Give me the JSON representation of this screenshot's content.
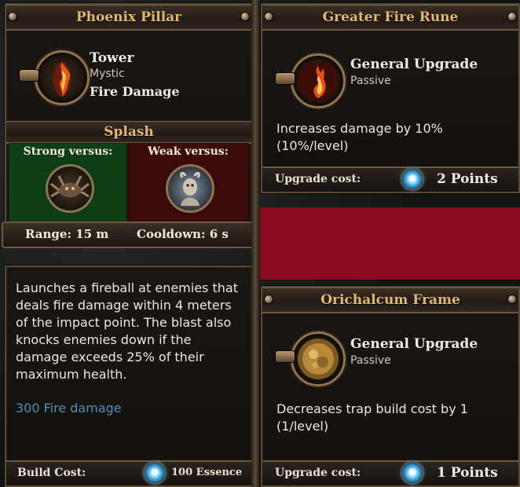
{
  "tower_card": {
    "title": "Phoenix Pillar",
    "type": "Tower",
    "school": "Mystic",
    "damage_type": "Fire Damage",
    "splash_label": "Splash",
    "strong_label": "Strong versus:",
    "weak_label": "Weak versus:",
    "range": "Range: 15 m",
    "cooldown": "Cooldown: 6 s",
    "description": "Launches a fireball at enemies that deals fire damage within 4 meters of the impact point. The blast also knocks enemies down if the damage exceeds 25% of their maximum health.",
    "stat": "300 Fire damage",
    "build_cost_label": "Build Cost:",
    "build_cost_value": "100 Essence"
  },
  "upgrade_1": {
    "title": "Greater Fire Rune",
    "category": "General Upgrade",
    "kind": "Passive",
    "description": "Increases damage by 10% (10%/level)",
    "cost_label": "Upgrade cost:",
    "cost_value": "2 Points"
  },
  "upgrade_2": {
    "title": "Orichalcum Frame",
    "category": "General Upgrade",
    "kind": "Passive",
    "description": "Decreases trap build cost by 1 (1/level)",
    "cost_label": "Upgrade cost:",
    "cost_value": "1 Points"
  },
  "colors": {
    "title_gold": "#e2b86e",
    "strong_bg": "#0f3d14",
    "weak_bg": "#3b0a0a",
    "stat_blue": "#4f8fb8",
    "redaction": "#8c0a1e"
  },
  "icons": {
    "tower": "phoenix-pillar-icon",
    "upgrade_1": "fire-rune-icon",
    "upgrade_2": "orichalcum-frame-icon",
    "strong_enemy": "spider-enemy-icon",
    "weak_enemy": "horned-beast-enemy-icon",
    "currency": "essence-gem-icon"
  }
}
